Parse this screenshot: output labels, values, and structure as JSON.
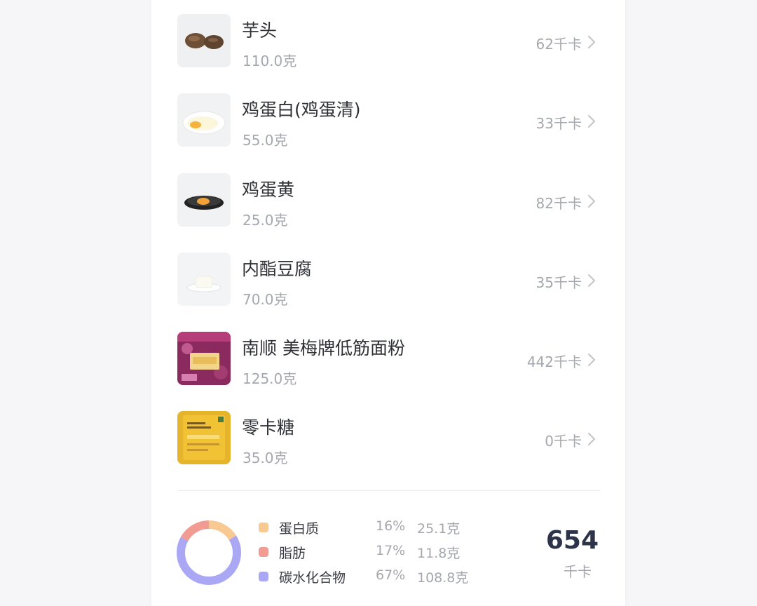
{
  "foods": [
    {
      "name": "芋头",
      "weight": "110.0克",
      "calories": "62千卡",
      "image_icon": "taro-photo"
    },
    {
      "name": "鸡蛋白(鸡蛋清)",
      "weight": "55.0克",
      "calories": "33千卡",
      "image_icon": "egg-white-photo"
    },
    {
      "name": "鸡蛋黄",
      "weight": "25.0克",
      "calories": "82千卡",
      "image_icon": "egg-yolk-photo"
    },
    {
      "name": "内酯豆腐",
      "weight": "70.0克",
      "calories": "35千卡",
      "image_icon": "tofu-photo"
    },
    {
      "name": "南顺 美梅牌低筋面粉",
      "weight": "125.0克",
      "calories": "442千卡",
      "image_icon": "flour-package-photo"
    },
    {
      "name": "零卡糖",
      "weight": "35.0克",
      "calories": "0千卡",
      "image_icon": "zero-cal-sugar-package-photo"
    }
  ],
  "nutrition": {
    "legend": [
      {
        "label": "蛋白质",
        "percent": "16%",
        "grams": "25.1克",
        "color": "#f8c993"
      },
      {
        "label": "脂肪",
        "percent": "17%",
        "grams": "11.8克",
        "color": "#f19b93"
      },
      {
        "label": "碳水化合物",
        "percent": "67%",
        "grams": "108.8克",
        "color": "#aaa7f5"
      }
    ],
    "total_value": "654",
    "total_unit": "千卡"
  }
}
